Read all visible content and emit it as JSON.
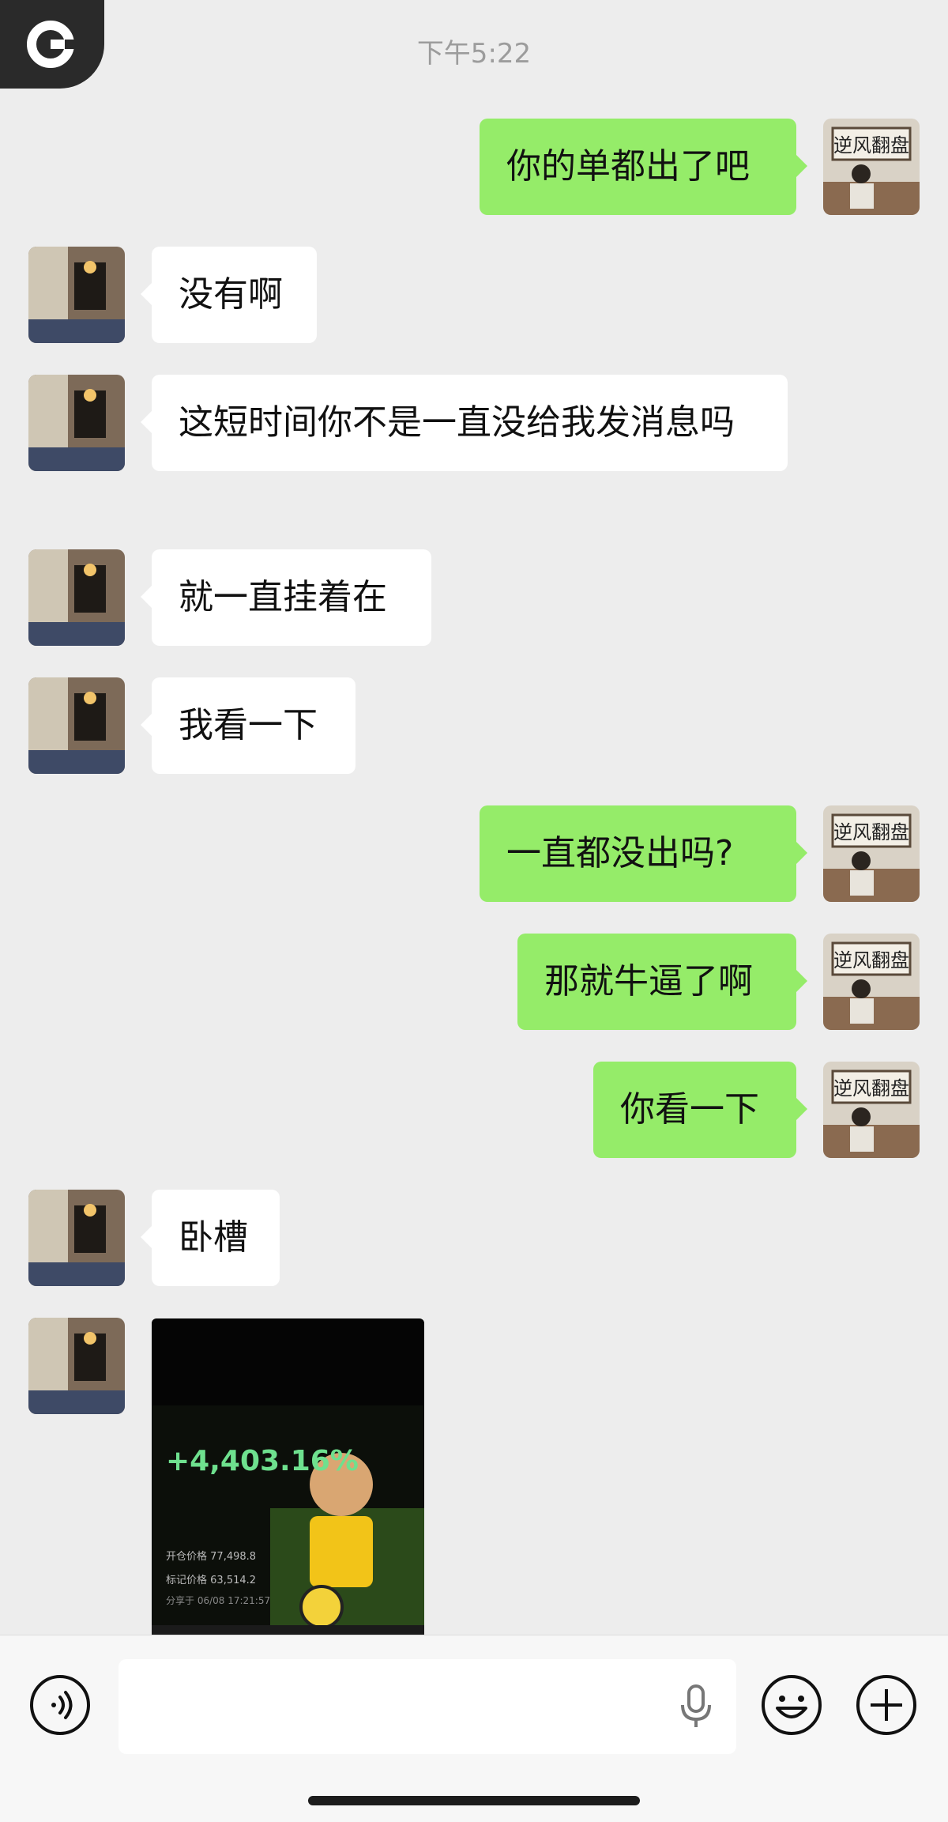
{
  "status": {
    "time": "下午5:22"
  },
  "messages": [
    {
      "id": "m1",
      "side": "out",
      "text": "你的单都出了吧"
    },
    {
      "id": "m2",
      "side": "in",
      "text": "没有啊"
    },
    {
      "id": "m3",
      "side": "in",
      "text": "这短时间你不是一直没给我发消息吗"
    },
    {
      "id": "m4",
      "side": "in",
      "text": "就一直挂着在"
    },
    {
      "id": "m5",
      "side": "in",
      "text": "我看一下"
    },
    {
      "id": "m6",
      "side": "out",
      "text": "一直都没出吗?"
    },
    {
      "id": "m7",
      "side": "out",
      "text": "那就牛逼了啊"
    },
    {
      "id": "m8",
      "side": "out",
      "text": "你看一下"
    },
    {
      "id": "m9",
      "side": "in",
      "text": "卧槽"
    }
  ],
  "image_message": {
    "percent": "+4,403.16%",
    "open_price_label": "开仓价格",
    "open_price": "77,498.8",
    "mark_price_label": "标记价格",
    "mark_price": "63,514.2",
    "shared_label": "分享于 06/08 17:21:57"
  },
  "avatar_sign": "逆风翻盘",
  "colors": {
    "background": "#ededed",
    "incoming_bubble": "#ffffff",
    "outgoing_bubble": "#95ec69",
    "profit_green": "#6ee08e"
  },
  "icons": {
    "voice": "voice-wave-icon",
    "mic": "microphone-icon",
    "emoji": "smiley-icon",
    "plus": "plus-circle-icon"
  }
}
